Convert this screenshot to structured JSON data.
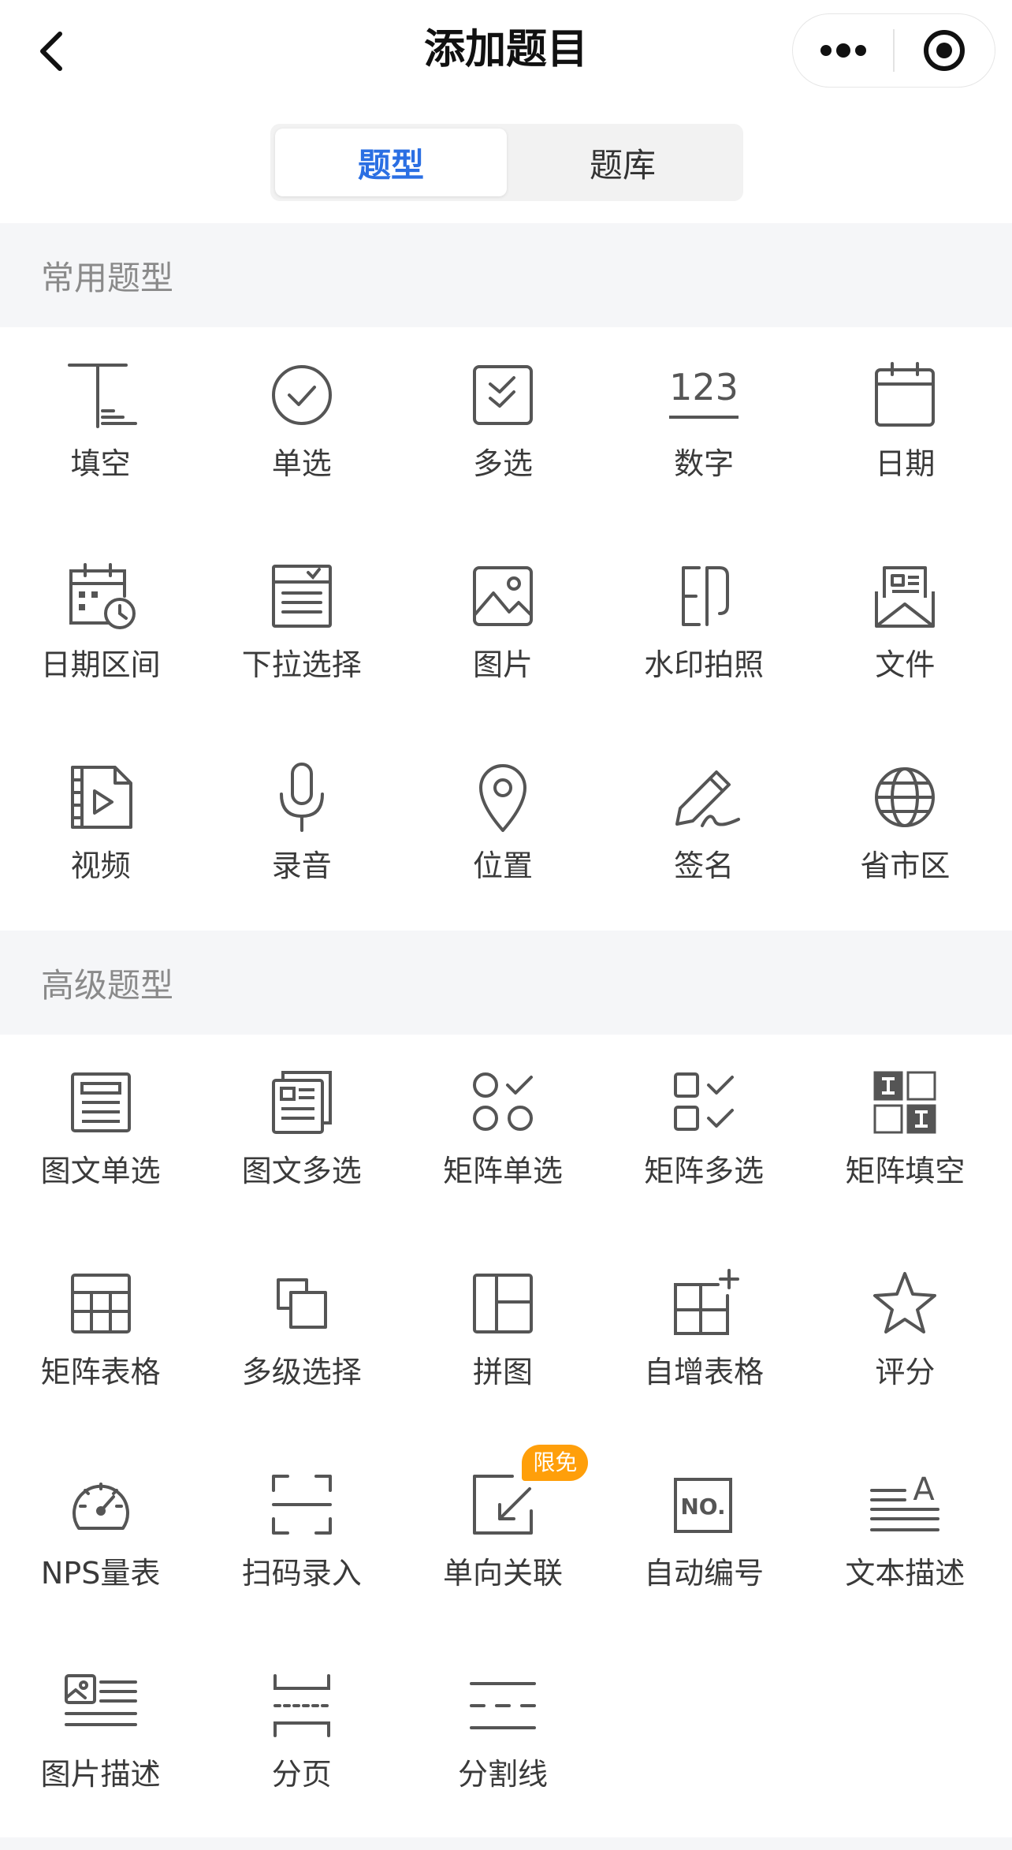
{
  "nav": {
    "title": "添加题目",
    "back_icon": "chevron-left-icon",
    "more_icon": "more-dots-icon",
    "close_icon": "target-circle-icon"
  },
  "tabs": [
    {
      "label": "题型",
      "active": true
    },
    {
      "label": "题库",
      "active": false
    }
  ],
  "colors": {
    "accent": "#2b6fe3",
    "badge": "#ff9f0a",
    "icon_stroke": "#555555",
    "section_bg": "#f5f6f8"
  },
  "sections": {
    "common": {
      "title": "常用题型",
      "items": [
        {
          "label": "填空",
          "icon": "fill-blank-icon"
        },
        {
          "label": "单选",
          "icon": "single-choice-icon"
        },
        {
          "label": "多选",
          "icon": "multi-choice-icon"
        },
        {
          "label": "数字",
          "icon": "number-icon",
          "glyph": "123"
        },
        {
          "label": "日期",
          "icon": "calendar-icon"
        },
        {
          "label": "日期区间",
          "icon": "date-range-icon"
        },
        {
          "label": "下拉选择",
          "icon": "dropdown-icon"
        },
        {
          "label": "图片",
          "icon": "image-icon"
        },
        {
          "label": "水印拍照",
          "icon": "watermark-photo-icon"
        },
        {
          "label": "文件",
          "icon": "file-icon"
        },
        {
          "label": "视频",
          "icon": "video-icon"
        },
        {
          "label": "录音",
          "icon": "microphone-icon"
        },
        {
          "label": "位置",
          "icon": "location-icon"
        },
        {
          "label": "签名",
          "icon": "signature-icon"
        },
        {
          "label": "省市区",
          "icon": "globe-icon"
        }
      ]
    },
    "advanced": {
      "title": "高级题型",
      "items": [
        {
          "label": "图文单选",
          "icon": "image-text-single-icon"
        },
        {
          "label": "图文多选",
          "icon": "image-text-multi-icon"
        },
        {
          "label": "矩阵单选",
          "icon": "matrix-single-icon"
        },
        {
          "label": "矩阵多选",
          "icon": "matrix-multi-icon"
        },
        {
          "label": "矩阵填空",
          "icon": "matrix-fill-icon"
        },
        {
          "label": "矩阵表格",
          "icon": "matrix-table-icon"
        },
        {
          "label": "多级选择",
          "icon": "cascade-select-icon"
        },
        {
          "label": "拼图",
          "icon": "puzzle-layout-icon"
        },
        {
          "label": "自增表格",
          "icon": "auto-table-icon"
        },
        {
          "label": "评分",
          "icon": "star-icon"
        },
        {
          "label": "NPS量表",
          "icon": "gauge-icon"
        },
        {
          "label": "扫码录入",
          "icon": "scan-icon"
        },
        {
          "label": "单向关联",
          "icon": "one-way-link-icon",
          "badge": "限免"
        },
        {
          "label": "自动编号",
          "icon": "auto-number-icon",
          "glyph": "NO."
        },
        {
          "label": "文本描述",
          "icon": "text-description-icon",
          "glyph": "A"
        },
        {
          "label": "图片描述",
          "icon": "image-description-icon"
        },
        {
          "label": "分页",
          "icon": "pagination-icon"
        },
        {
          "label": "分割线",
          "icon": "divider-line-icon"
        }
      ]
    }
  }
}
